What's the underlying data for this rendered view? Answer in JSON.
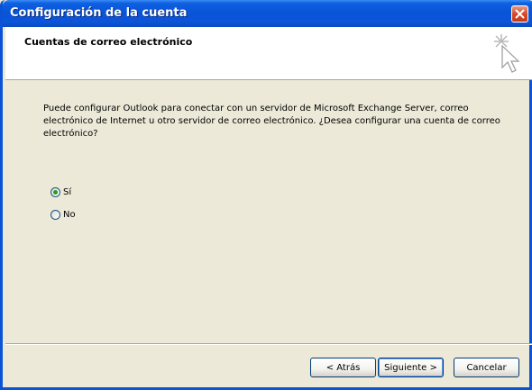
{
  "window": {
    "title": "Configuración de la cuenta"
  },
  "header": {
    "title": "Cuentas de correo electrónico"
  },
  "main": {
    "description": "Puede configurar Outlook para conectar con un servidor de Microsoft Exchange Server, correo electrónico de Internet u otro servidor de correo electrónico. ¿Desea configurar una cuenta de correo electrónico?",
    "options": [
      {
        "label": "Sí",
        "selected": true
      },
      {
        "label": "No",
        "selected": false
      }
    ]
  },
  "footer": {
    "back_label": "< Atrás",
    "next_label": "Siguiente >",
    "cancel_label": "Cancelar"
  },
  "colors": {
    "titlebar": "#0a54d8",
    "close": "#d6492a",
    "radio_dot": "#21a121",
    "background": "#ece9d8"
  },
  "icons": [
    "close-icon",
    "wizard-sparkle-cursor-icon"
  ]
}
